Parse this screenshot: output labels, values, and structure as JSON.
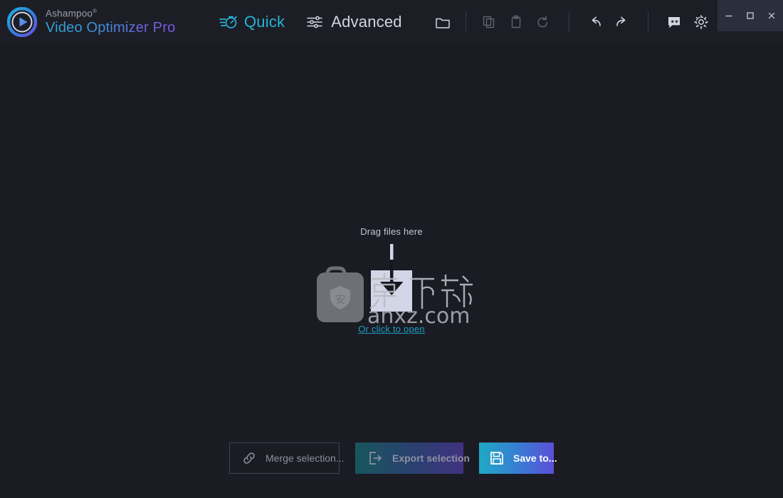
{
  "app": {
    "brand_sup": "Ashampoo",
    "brand_sup_mark": "®",
    "brand_name": "Video Optimizer Pro",
    "logo_icon": "play-circle-icon"
  },
  "nav": {
    "tabs": [
      {
        "id": "quick",
        "label": "Quick",
        "icon": "stopwatch-icon",
        "active": true,
        "color": "#23b6d6"
      },
      {
        "id": "advanced",
        "label": "Advanced",
        "icon": "sliders-icon",
        "active": false,
        "color": "#d2d4de"
      }
    ]
  },
  "toolbar": {
    "buttons": [
      {
        "id": "open-folder",
        "icon": "folder-icon",
        "enabled": true
      },
      {
        "id": "copy",
        "icon": "copy-icon",
        "enabled": false
      },
      {
        "id": "paste",
        "icon": "clipboard-icon",
        "enabled": false
      },
      {
        "id": "reset",
        "icon": "reset-icon",
        "enabled": false
      },
      {
        "id": "undo",
        "icon": "undo-icon",
        "enabled": true
      },
      {
        "id": "redo",
        "icon": "redo-icon",
        "enabled": true
      },
      {
        "id": "rate",
        "icon": "rating-bubble-icon",
        "enabled": true
      },
      {
        "id": "settings",
        "icon": "gear-icon",
        "enabled": true
      },
      {
        "id": "theme",
        "icon": "theme-contrast-icon",
        "enabled": true
      },
      {
        "id": "info",
        "icon": "info-circle-icon",
        "enabled": true
      }
    ]
  },
  "window_controls": {
    "minimize": {
      "icon": "minimize-icon",
      "glyph": "—"
    },
    "maximize": {
      "icon": "maximize-icon",
      "glyph": "□"
    },
    "close": {
      "icon": "close-icon",
      "glyph": "×"
    }
  },
  "dropzone": {
    "title": "Drag files here",
    "link": "Or click to open",
    "icon": "download-into-box-icon"
  },
  "watermark": {
    "text_cn": "安下载",
    "text_domain": "anxz.com",
    "badge_char": "安",
    "icon": "briefcase-shield-icon"
  },
  "footer": {
    "merge": {
      "label": "Merge selection...",
      "icon": "link-chain-icon",
      "enabled": true
    },
    "export": {
      "label": "Export selection",
      "icon": "export-arrow-icon",
      "enabled": false
    },
    "save": {
      "label": "Save to...",
      "icon": "floppy-disk-icon",
      "enabled": true
    }
  },
  "colors": {
    "background": "#1b1b23",
    "header": "#1d1d26",
    "accent_cyan": "#23b6d6",
    "accent_purple": "#5b4fd8",
    "link": "#1d9fc4",
    "titlebar_chrome": "#2a2e3d"
  }
}
